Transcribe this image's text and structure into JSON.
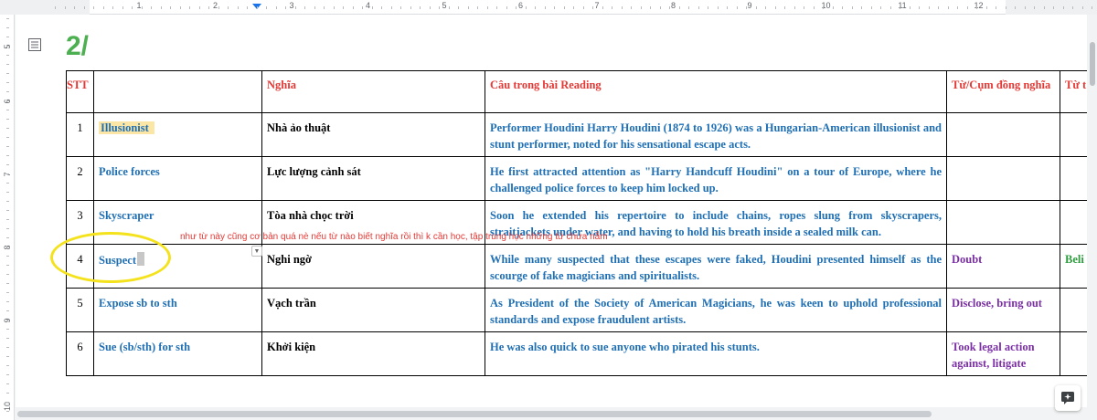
{
  "ruler": {
    "numbers": [
      "1",
      "2",
      "3",
      "4",
      "5",
      "6",
      "7",
      "8",
      "9",
      "10",
      "11",
      "12"
    ],
    "vertical_numbers": [
      "5",
      "6",
      "7",
      "8",
      "9",
      "10"
    ]
  },
  "document": {
    "heading": "2/"
  },
  "table": {
    "headers": {
      "stt": "STT",
      "word": "",
      "meaning": "Nghĩa",
      "sentence": "Câu trong bài Reading",
      "synonym": "Từ/Cụm đồng nghĩa",
      "antonym": "Từ t"
    },
    "rows": [
      {
        "stt": "1",
        "word": "Illusionist",
        "meaning": "Nhà ảo thuật",
        "sentence": "Performer Houdini Harry Houdini (1874 to 1926) was a Hungarian-American illusionist and stunt performer, noted for his sensational escape acts.",
        "synonym": "",
        "antonym": ""
      },
      {
        "stt": "2",
        "word": "Police forces",
        "meaning": "Lực lượng cảnh sát",
        "sentence": "He first attracted attention as \"Harry Handcuff Houdini\" on a tour of Europe, where he challenged police forces to keep him locked up.",
        "synonym": "",
        "antonym": ""
      },
      {
        "stt": "3",
        "word": "Skyscraper",
        "meaning": "Tòa nhà chọc trời",
        "sentence": "Soon he extended his repertoire to include chains, ropes slung from skyscrapers, straitjackets under water, and having to hold his breath inside a sealed milk can.",
        "synonym": "",
        "antonym": ""
      },
      {
        "stt": "4",
        "word": "Suspect",
        "meaning": "Nghi ngờ",
        "sentence": "While many suspected that these escapes were faked, Houdini presented himself as the scourge of fake magicians and spiritualists.",
        "synonym": "Doubt",
        "antonym": "Beli"
      },
      {
        "stt": "5",
        "word": "Expose sb to sth",
        "meaning": "Vạch trần",
        "sentence": "As President of the Society of American Magicians, he was keen to uphold professional standards and expose fraudulent artists.",
        "synonym": "Disclose, bring out",
        "antonym": ""
      },
      {
        "stt": "6",
        "word": "Sue (sb/sth) for sth",
        "meaning": "Khởi kiện",
        "sentence": "He was also quick to sue anyone who pirated his stunts.",
        "synonym": "Took legal action against, litigate",
        "antonym": ""
      }
    ]
  },
  "annotation": {
    "note": "như từ này cũng cơ bản quá nè nếu từ nào biết nghĩa rồi thì k cần học, tập trung học những từ chưa nắm"
  },
  "colors": {
    "heading": "#4caf50",
    "header_text": "#e53935",
    "word_text": "#1f6fb4",
    "synonym_text": "#7b2fa5",
    "antonym_text": "#2e9e3f",
    "highlight": "#fbe6a6",
    "ellipse": "#f4e21c"
  },
  "icons": {
    "outline": "document-outline-icon",
    "explore": "explore-sparkle-icon",
    "dropdown": "chevron-down-icon"
  }
}
